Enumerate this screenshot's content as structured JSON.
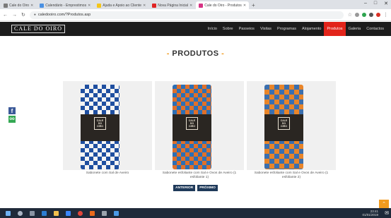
{
  "browser": {
    "tabs": [
      {
        "title": "Cale do Oiro",
        "active": false,
        "color": "#7a7a7a"
      },
      {
        "title": "Calendário - Emprestimos",
        "active": false,
        "color": "#4a90e2"
      },
      {
        "title": "Ajuda e Apoio ao Cliente",
        "active": false,
        "color": "#f5c518"
      },
      {
        "title": "Nova Página Inicial",
        "active": false,
        "color": "#e02424"
      },
      {
        "title": "Cale do Oiro - Produtos",
        "active": true,
        "color": "#d63384"
      }
    ],
    "newtab_symbol": "+",
    "window_controls": [
      "–",
      "□",
      "✕"
    ],
    "url": "caledooiro.com/?Produtos.asp",
    "back": "←",
    "forward": "→",
    "reload": "↻"
  },
  "site": {
    "logo": "CALE DO OIRO",
    "menu": [
      {
        "label": "Início",
        "active": false
      },
      {
        "label": "Sobre",
        "active": false
      },
      {
        "label": "Passeios",
        "active": false
      },
      {
        "label": "Visitas",
        "active": false
      },
      {
        "label": "Programas",
        "active": false
      },
      {
        "label": "Alojamento",
        "active": false
      },
      {
        "label": "Produtos",
        "active": true
      },
      {
        "label": "Galeria",
        "active": false
      },
      {
        "label": "Contactos",
        "active": false
      }
    ],
    "accent_color": "#e2241a"
  },
  "social": {
    "facebook": "f",
    "tripadvisor": "oo"
  },
  "page": {
    "heading_dash": "-",
    "heading": "PRODUTOS",
    "products": [
      {
        "caption": "Sabonete com Sal de Aveiro",
        "style": "blue",
        "badge": "CALE DO OIRO"
      },
      {
        "caption": "Sabonete esfoliante com Sal e Ovos de Aveiro (1 esfoliante 1)",
        "style": "orange-blue",
        "badge": "CALE DO OIRO"
      },
      {
        "caption": "Sabonete esfoliante com Sal e Ovos de Aveiro (1 esfoliante 2)",
        "style": "orange",
        "badge": "CALE DO OIRO"
      }
    ],
    "prev_label": "ANTERIOR",
    "next_label": "PRÓXIMO",
    "to_top": "⌃"
  },
  "taskbar": {
    "time": "23:41",
    "date": "01/01/2019",
    "notification": "✉"
  }
}
